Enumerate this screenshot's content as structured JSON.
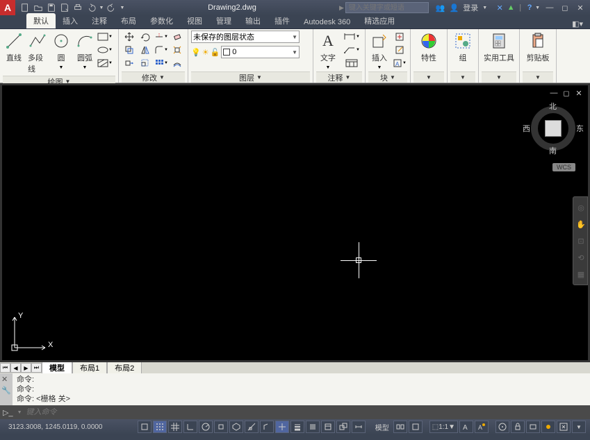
{
  "title": "Drawing2.dwg",
  "search_placeholder": "键入关键字或短语",
  "login": {
    "label": "登录"
  },
  "tabs": [
    "默认",
    "插入",
    "注释",
    "布局",
    "参数化",
    "视图",
    "管理",
    "输出",
    "插件",
    "Autodesk 360",
    "精选应用"
  ],
  "active_tab": 0,
  "ribbon": {
    "draw": {
      "title": "绘图",
      "line": "直线",
      "polyline": "多段线",
      "circle": "圆",
      "arc": "圆弧"
    },
    "modify": {
      "title": "修改"
    },
    "layers": {
      "title": "图层",
      "state": "未保存的图层状态",
      "current": "0"
    },
    "annotation": {
      "title": "注释",
      "text": "文字"
    },
    "block": {
      "title": "块",
      "insert": "插入"
    },
    "properties": {
      "title": "特性"
    },
    "groups": {
      "title": "组"
    },
    "utilities": {
      "title": "实用工具"
    },
    "clipboard": {
      "title": "剪贴板"
    }
  },
  "viewcube": {
    "n": "北",
    "s": "南",
    "e": "东",
    "w": "西",
    "wcs": "WCS"
  },
  "layout_tabs": [
    "模型",
    "布局1",
    "布局2"
  ],
  "active_layout": 0,
  "command": {
    "history": [
      "命令:",
      "命令:",
      "命令:  <栅格 关>"
    ],
    "placeholder": "键入命令"
  },
  "status": {
    "coords": "3123.3008, 1245.0119, 0.0000",
    "model": "模型",
    "scale": "1:1"
  },
  "help_icon": "?"
}
